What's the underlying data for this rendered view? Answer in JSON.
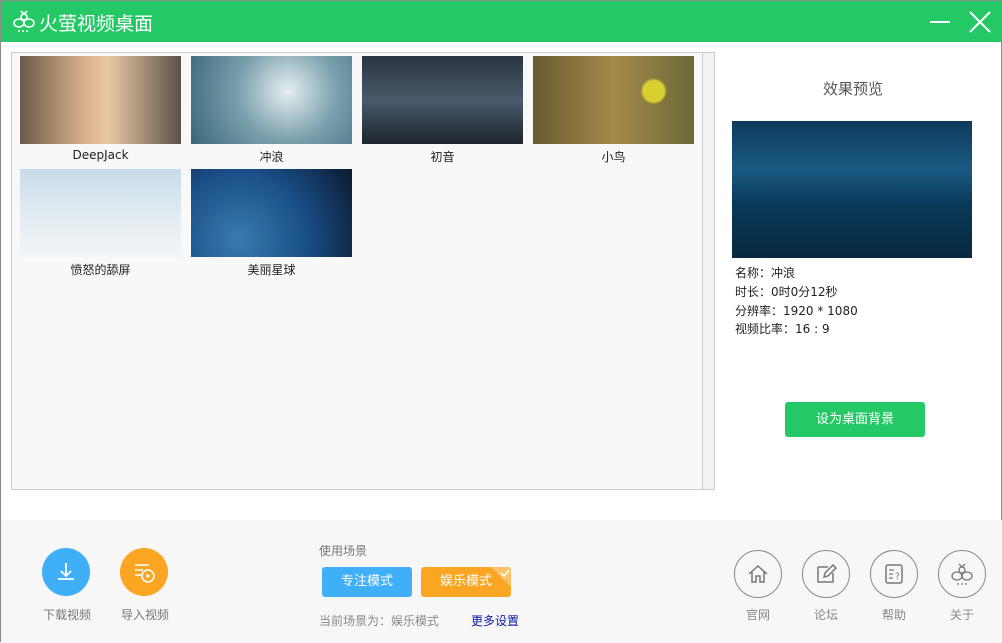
{
  "app": {
    "title": "火萤视频桌面"
  },
  "videos": [
    {
      "name": "DeepJack"
    },
    {
      "name": "冲浪"
    },
    {
      "name": "初音"
    },
    {
      "name": "小鸟"
    },
    {
      "name": "愤怒的舔屏"
    },
    {
      "name": "美丽星球"
    }
  ],
  "preview": {
    "heading": "效果预览",
    "name": "名称：冲浪",
    "duration": "时长：0时0分12秒",
    "resolution": "分辨率：1920 * 1080",
    "ratio": "视频比率：16 : 9",
    "set_button": "设为桌面背景"
  },
  "bottom": {
    "download": "下载视频",
    "import": "导入视频",
    "scene_label": "使用场景",
    "focus_mode": "专注模式",
    "fun_mode": "娱乐模式",
    "current_scene": "当前场景为：娱乐模式",
    "more_settings": "更多设置",
    "links": [
      "官网",
      "论坛",
      "帮助",
      "关于"
    ]
  },
  "colors": {
    "brand": "#24c965",
    "blue": "#3fb0f7",
    "orange": "#fba622"
  }
}
